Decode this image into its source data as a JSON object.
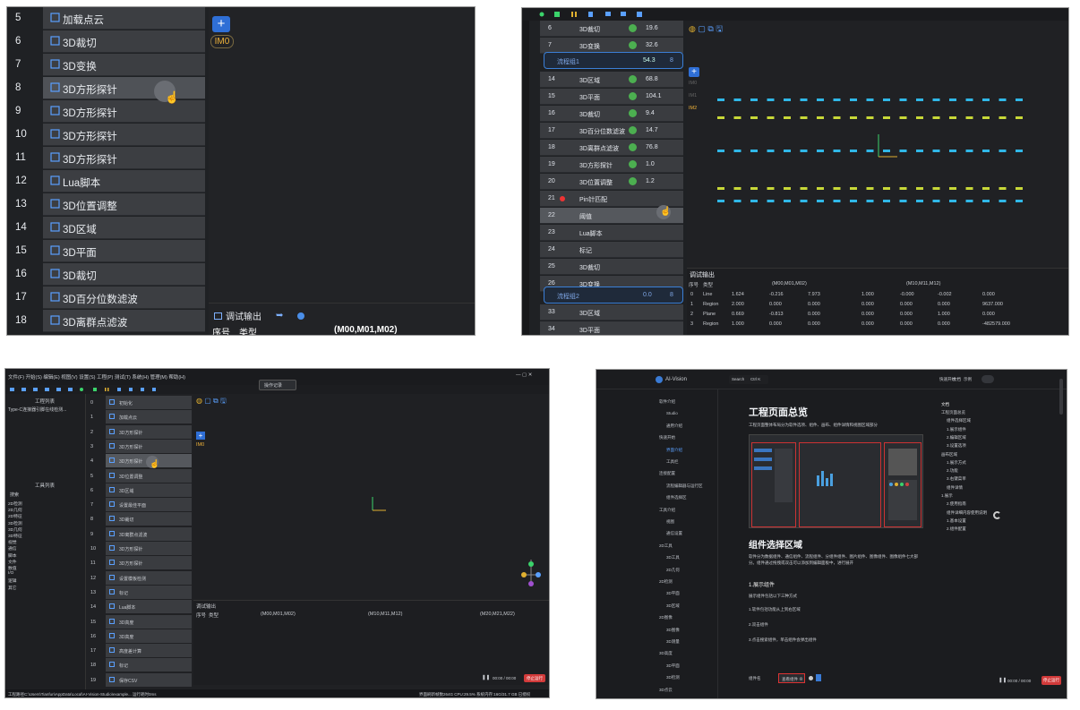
{
  "panel1": {
    "rows": [
      {
        "num": "5",
        "label": "加载点云"
      },
      {
        "num": "6",
        "label": "3D裁切"
      },
      {
        "num": "7",
        "label": "3D变换"
      },
      {
        "num": "8",
        "label": "3D方形探针"
      },
      {
        "num": "9",
        "label": "3D方形探针"
      },
      {
        "num": "10",
        "label": "3D方形探针"
      },
      {
        "num": "11",
        "label": "3D方形探针"
      },
      {
        "num": "12",
        "label": "Lua脚本"
      },
      {
        "num": "13",
        "label": "3D位置调整"
      },
      {
        "num": "14",
        "label": "3D区域"
      },
      {
        "num": "15",
        "label": "3D平面"
      },
      {
        "num": "16",
        "label": "3D裁切"
      },
      {
        "num": "17",
        "label": "3D百分位数滤波"
      },
      {
        "num": "18",
        "label": "3D离群点滤波"
      }
    ],
    "image_tag": "IM0",
    "bottom_title": "调试输出",
    "col_seq": "序号",
    "col_type": "类型",
    "col_matrix": "(M00,M01,M02)"
  },
  "panel2": {
    "rows": [
      {
        "num": "6",
        "label": "3D裁切",
        "val": "19.6",
        "ok": true
      },
      {
        "num": "7",
        "label": "3D变换",
        "val": "32.6",
        "ok": true
      },
      {
        "num": "14",
        "label": "3D区域",
        "val": "68.8",
        "ok": true
      },
      {
        "num": "15",
        "label": "3D平面",
        "val": "104.1",
        "ok": true
      },
      {
        "num": "16",
        "label": "3D裁切",
        "val": "9.4",
        "ok": true
      },
      {
        "num": "17",
        "label": "3D百分位数滤波",
        "val": "14.7",
        "ok": true
      },
      {
        "num": "18",
        "label": "3D离群点滤波",
        "val": "76.8",
        "ok": true
      },
      {
        "num": "19",
        "label": "3D方形探针",
        "val": "1.0",
        "ok": true
      },
      {
        "num": "20",
        "label": "3D位置调整",
        "val": "1.2",
        "ok": true
      },
      {
        "num": "21",
        "label": "Pin针匹配",
        "val": "",
        "ok": false
      },
      {
        "num": "22",
        "label": "阈值",
        "val": "",
        "ok": false
      },
      {
        "num": "23",
        "label": "Lua脚本",
        "val": "",
        "ok": false
      },
      {
        "num": "24",
        "label": "标记",
        "val": "",
        "ok": false
      },
      {
        "num": "25",
        "label": "3D裁切",
        "val": "",
        "ok": false
      },
      {
        "num": "26",
        "label": "3D变换",
        "val": "",
        "ok": false
      },
      {
        "num": "33",
        "label": "3D区域",
        "val": "",
        "ok": false
      },
      {
        "num": "34",
        "label": "3D平面",
        "val": "",
        "ok": false
      }
    ],
    "group1": {
      "label": "流程组1",
      "val": "54.3",
      "count": "8"
    },
    "group2": {
      "label": "流程组2",
      "val": "0.0",
      "count": "8"
    },
    "image_tags": [
      "IM0",
      "IM1",
      "IM2"
    ],
    "debug_title": "调试输出",
    "table": {
      "headers": [
        "序号",
        "类型",
        "(M00,M01,M02)",
        "(M10,M11,M12)"
      ],
      "rows": [
        [
          "0",
          "Line",
          "1.624",
          "-0.216",
          "7.973",
          "1.000",
          "-0.000",
          "-0.002",
          "0.000"
        ],
        [
          "1",
          "Region",
          "2.000",
          "0.000",
          "0.000",
          "0.000",
          "0.000",
          "0.000",
          "9637.000"
        ],
        [
          "2",
          "Plane",
          "0.669",
          "-0.813",
          "0.000",
          "0.000",
          "0.000",
          "1.000",
          "0.000"
        ],
        [
          "3",
          "Region",
          "1.000",
          "0.000",
          "0.000",
          "0.000",
          "0.000",
          "0.000",
          "-482579.000"
        ]
      ]
    }
  },
  "panel3": {
    "menu": "文件(F) 开始(S) 编辑(E) 视图(V) 设置(S) 工程(P) 测试(T) 系统(H) 管理(M) 帮助(H)",
    "project_title": "工程列表",
    "project_item": "Type-C连接器引脚在线检测...",
    "tools_title": "工具列表",
    "tools_search": "搜索",
    "tools": [
      "2D检测",
      "2D几何",
      "2D特征",
      "3D检测",
      "3D几何",
      "3D特征",
      "视觉",
      "通信",
      "脚本",
      "文件",
      "数值",
      "I/O",
      "逻辑",
      "其它"
    ],
    "rows": [
      {
        "num": "0",
        "label": "初始化"
      },
      {
        "num": "1",
        "label": "加载点云"
      },
      {
        "num": "2",
        "label": "3D方形探针"
      },
      {
        "num": "3",
        "label": "3D方形探针"
      },
      {
        "num": "4",
        "label": "3D方形探针"
      },
      {
        "num": "5",
        "label": "3D位置调整"
      },
      {
        "num": "6",
        "label": "3D区域"
      },
      {
        "num": "7",
        "label": "设置最佳平面"
      },
      {
        "num": "8",
        "label": "3D裁切"
      },
      {
        "num": "9",
        "label": "3D离群点滤波"
      },
      {
        "num": "10",
        "label": "3D方形探针"
      },
      {
        "num": "11",
        "label": "3D方形探针"
      },
      {
        "num": "12",
        "label": "设置模板检测"
      },
      {
        "num": "13",
        "label": "标记"
      },
      {
        "num": "14",
        "label": "Lua脚本"
      },
      {
        "num": "15",
        "label": "3D高度"
      },
      {
        "num": "16",
        "label": "3D高度"
      },
      {
        "num": "17",
        "label": "高度差计算"
      },
      {
        "num": "18",
        "label": "标记"
      },
      {
        "num": "19",
        "label": "保存CSV"
      }
    ],
    "image_tag": "IM0",
    "float_label": "操作记录",
    "debug_title": "调试输出",
    "col_seq": "序号",
    "col_type": "类型",
    "cols": [
      "(M00,M01,M02)",
      "(M10,M11,M12)",
      "(M20,M21,M22)"
    ],
    "time": "00:00 / 00:00",
    "status": "工程路径C:\\Users\\Tianfun\\AppData\\Local\\AI-Vision-Studio\\example...   运行耗时0ms",
    "status_right": "界面刷新帧数264G  CPU:29.5%  系统内存:16G/31.7 GB  已授权",
    "run_btn": "停止运行"
  },
  "panel4": {
    "brand": "AI-Vision",
    "search": "Search",
    "kbd": "Ctrl K",
    "top_links": [
      "快速开始",
      "文档",
      "示例"
    ],
    "nav": [
      "软件介绍",
      "Studio",
      "通用介绍",
      "快速开始",
      "界面介绍",
      "工具栏",
      "连接配置",
      "流程编辑器与运行区",
      "组件选择区",
      "工具介绍",
      "视图",
      "通信设置",
      "2D工具",
      "3D工具",
      "2D几何",
      "2D检测",
      "3D平面",
      "3D区域",
      "2D图像",
      "3D图像",
      "3D测量",
      "3D高度",
      "3D平面",
      "3D检测",
      "3D点云"
    ],
    "h1": "工程页面总览",
    "intro": "工程页面整体布局分为软件选项、组件、画布、组件详情和视图区域部分",
    "h2": "组件选择区域",
    "para": "软件分为数据组件、通信组件、流程组件、分组件组件、图片组件、图像组件、图像组件七大部分。组件通过拖拽或双击可以添加到编辑面板中，进行展开",
    "h3": "1.展示组件",
    "p3": "展示组件包括以下三种方式",
    "p4": "1.软件包括功能从上到右区域",
    "p5": "2.双击组件",
    "p6": "3.点击搜索组件，单击组件会弹出组件",
    "bottom_label": "组件名",
    "bottom_btn": "查看组件 ⊕",
    "toc_title": "文档",
    "toc": [
      "工程页面总览",
      "组件选择区域",
      "1.展示组件",
      "2.编辑区域",
      "3.设置选项",
      "画布区域",
      "1.展示方式",
      "2.功能",
      "3.右键菜单",
      "组件详情",
      "1.展示",
      "2.使用指南",
      "组件详细内容使用说明",
      "1.基本设置",
      "2.组件配置"
    ],
    "time": "00:00 / 00:00",
    "btn": "停止运行"
  }
}
